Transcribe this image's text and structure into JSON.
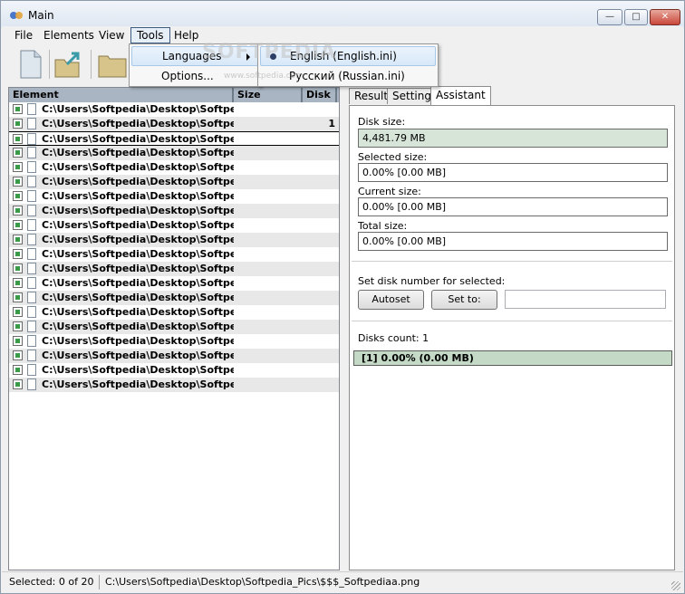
{
  "window": {
    "title": "Main"
  },
  "menubar": {
    "items": [
      "File",
      "Elements",
      "View",
      "Tools",
      "Help"
    ]
  },
  "tools_menu": {
    "items": [
      "Languages",
      "Options..."
    ],
    "languages_submenu": [
      "English (English.ini)",
      "Русский (Russian.ini)"
    ],
    "selected_language": "English (English.ini)"
  },
  "toolbar": {
    "buttons": [
      "new-file-icon",
      "export-icon",
      "folder-icon"
    ]
  },
  "list": {
    "columns": [
      "Element",
      "Size",
      "Disk"
    ],
    "rows": [
      {
        "path": "C:\\Users\\Softpedia\\Desktop\\Softpedi",
        "disk": ""
      },
      {
        "path": "C:\\Users\\Softpedia\\Desktop\\Softpedi",
        "disk": "1"
      },
      {
        "path": "C:\\Users\\Softpedia\\Desktop\\Softpedi",
        "disk": ""
      },
      {
        "path": "C:\\Users\\Softpedia\\Desktop\\Softpedi",
        "disk": ""
      },
      {
        "path": "C:\\Users\\Softpedia\\Desktop\\Softpedi",
        "disk": ""
      },
      {
        "path": "C:\\Users\\Softpedia\\Desktop\\Softpedi",
        "disk": ""
      },
      {
        "path": "C:\\Users\\Softpedia\\Desktop\\Softpedi",
        "disk": ""
      },
      {
        "path": "C:\\Users\\Softpedia\\Desktop\\Softpedi",
        "disk": ""
      },
      {
        "path": "C:\\Users\\Softpedia\\Desktop\\Softpedi",
        "disk": ""
      },
      {
        "path": "C:\\Users\\Softpedia\\Desktop\\Softpedi",
        "disk": ""
      },
      {
        "path": "C:\\Users\\Softpedia\\Desktop\\Softpedi",
        "disk": ""
      },
      {
        "path": "C:\\Users\\Softpedia\\Desktop\\Softpedi",
        "disk": ""
      },
      {
        "path": "C:\\Users\\Softpedia\\Desktop\\Softpedi",
        "disk": ""
      },
      {
        "path": "C:\\Users\\Softpedia\\Desktop\\Softpedi",
        "disk": ""
      },
      {
        "path": "C:\\Users\\Softpedia\\Desktop\\Softpedi",
        "disk": ""
      },
      {
        "path": "C:\\Users\\Softpedia\\Desktop\\Softpedi",
        "disk": ""
      },
      {
        "path": "C:\\Users\\Softpedia\\Desktop\\Softpedi",
        "disk": ""
      },
      {
        "path": "C:\\Users\\Softpedia\\Desktop\\Softpedi",
        "disk": ""
      },
      {
        "path": "C:\\Users\\Softpedia\\Desktop\\Softpedi",
        "disk": ""
      },
      {
        "path": "C:\\Users\\Softpedia\\Desktop\\Softpedi",
        "disk": ""
      }
    ]
  },
  "tabs": [
    "Result",
    "Settings",
    "Assistant"
  ],
  "assistant": {
    "disk_size_label": "Disk size:",
    "disk_size_value": "4,481.79 MB",
    "selected_size_label": "Selected size:",
    "selected_size_value": "0.00% [0.00 MB]",
    "current_size_label": "Current size:",
    "current_size_value": "0.00% [0.00 MB]",
    "total_size_label": "Total size:",
    "total_size_value": "0.00% [0.00 MB]",
    "set_disk_label": "Set disk number for selected:",
    "autoset_label": "Autoset",
    "set_to_label": "Set to:",
    "set_to_value": "",
    "disks_count_label": "Disks count: 1",
    "disks": [
      "[1] 0.00% (0.00 MB)"
    ]
  },
  "status": {
    "selected": "Selected: 0 of 20",
    "path": "C:\\Users\\Softpedia\\Desktop\\Softpedia_Pics\\$$$_Softpediaa.png"
  },
  "watermark": {
    "text": "SOFTPEDIA",
    "sub": "www.softpedia.com"
  },
  "colors": {
    "header": "#a9b5c2",
    "field_green": "#d7e5d8",
    "disk_green": "#c4dac6"
  }
}
